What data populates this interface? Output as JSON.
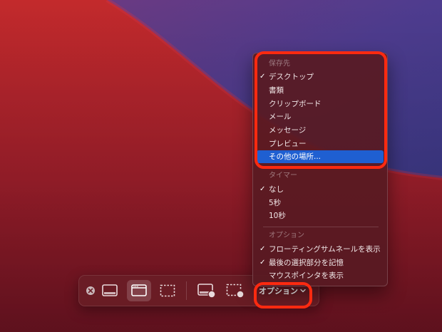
{
  "colors": {
    "annotation": "#ff2a10",
    "menu_highlight": "#1f5fd1",
    "wallpaper_red": "#b8242d",
    "wallpaper_purple": "#4b3c8e"
  },
  "toolbar": {
    "close_icon": "close-circle-icon",
    "buttons": [
      {
        "name": "capture-entire-screen-button",
        "icon": "entire-screen-icon",
        "selected": false
      },
      {
        "name": "capture-window-button",
        "icon": "window-icon",
        "selected": true
      },
      {
        "name": "capture-selection-button",
        "icon": "selection-icon",
        "selected": false
      },
      {
        "name": "record-entire-screen-button",
        "icon": "record-screen-icon",
        "selected": false
      },
      {
        "name": "record-selection-button",
        "icon": "record-selection-icon",
        "selected": false
      }
    ],
    "options_label": "オプション"
  },
  "menu": {
    "save_to_header": "保存先",
    "save_to_items": [
      {
        "label": "デスクトップ",
        "checked": true
      },
      {
        "label": "書類",
        "checked": false
      },
      {
        "label": "クリップボード",
        "checked": false
      },
      {
        "label": "メール",
        "checked": false
      },
      {
        "label": "メッセージ",
        "checked": false
      },
      {
        "label": "プレビュー",
        "checked": false
      },
      {
        "label": "その他の場所...",
        "checked": false,
        "highlighted": true
      }
    ],
    "timer_header": "タイマー",
    "timer_items": [
      {
        "label": "なし",
        "checked": true
      },
      {
        "label": "5秒",
        "checked": false
      },
      {
        "label": "10秒",
        "checked": false
      }
    ],
    "options_header": "オプション",
    "options_items": [
      {
        "label": "フローティングサムネールを表示",
        "checked": true
      },
      {
        "label": "最後の選択部分を記憶",
        "checked": true
      },
      {
        "label": "マウスポインタを表示",
        "checked": false
      }
    ]
  }
}
